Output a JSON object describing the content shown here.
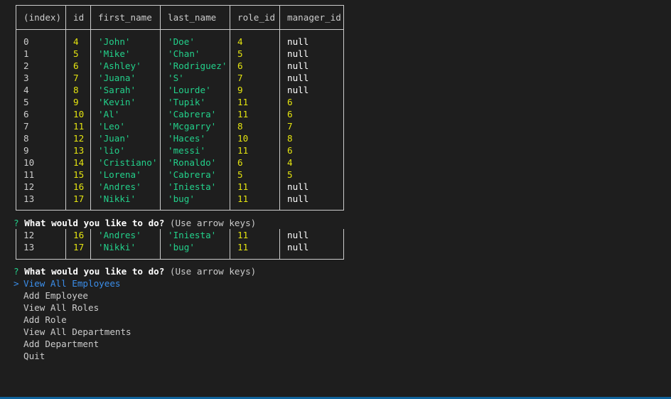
{
  "table": {
    "columns": [
      "(index)",
      "id",
      "first_name",
      "last_name",
      "role_id",
      "manager_id"
    ],
    "rows": [
      {
        "index": "0",
        "id": "4",
        "first_name": "'John'",
        "last_name": "'Doe'",
        "role_id": "4",
        "manager_id": "null"
      },
      {
        "index": "1",
        "id": "5",
        "first_name": "'Mike'",
        "last_name": "'Chan'",
        "role_id": "5",
        "manager_id": "null"
      },
      {
        "index": "2",
        "id": "6",
        "first_name": "'Ashley'",
        "last_name": "'Rodriguez'",
        "role_id": "6",
        "manager_id": "null"
      },
      {
        "index": "3",
        "id": "7",
        "first_name": "'Juana'",
        "last_name": "'S'",
        "role_id": "7",
        "manager_id": "null"
      },
      {
        "index": "4",
        "id": "8",
        "first_name": "'Sarah'",
        "last_name": "'Lourde'",
        "role_id": "9",
        "manager_id": "null"
      },
      {
        "index": "5",
        "id": "9",
        "first_name": "'Kevin'",
        "last_name": "'Tupik'",
        "role_id": "11",
        "manager_id": "6"
      },
      {
        "index": "6",
        "id": "10",
        "first_name": "'Al'",
        "last_name": "'Cabrera'",
        "role_id": "11",
        "manager_id": "6"
      },
      {
        "index": "7",
        "id": "11",
        "first_name": "'Leo'",
        "last_name": "'Mcgarry'",
        "role_id": "8",
        "manager_id": "7"
      },
      {
        "index": "8",
        "id": "12",
        "first_name": "'Juan'",
        "last_name": "'Haces'",
        "role_id": "10",
        "manager_id": "8"
      },
      {
        "index": "9",
        "id": "13",
        "first_name": "'lio'",
        "last_name": "'messi'",
        "role_id": "11",
        "manager_id": "6"
      },
      {
        "index": "10",
        "id": "14",
        "first_name": "'Cristiano'",
        "last_name": "'Ronaldo'",
        "role_id": "6",
        "manager_id": "4"
      },
      {
        "index": "11",
        "id": "15",
        "first_name": "'Lorena'",
        "last_name": "'Cabrera'",
        "role_id": "5",
        "manager_id": "5"
      },
      {
        "index": "12",
        "id": "16",
        "first_name": "'Andres'",
        "last_name": "'Iniesta'",
        "role_id": "11",
        "manager_id": "null"
      },
      {
        "index": "13",
        "id": "17",
        "first_name": "'Nikki'",
        "last_name": "'bug'",
        "role_id": "11",
        "manager_id": "null"
      }
    ]
  },
  "prompt_first": {
    "mark": "?",
    "question": "What would you like to do?",
    "hint": "(Use arrow keys)"
  },
  "partial_table": {
    "rows": [
      {
        "index": "12",
        "id": "16",
        "first_name": "'Andres'",
        "last_name": "'Iniesta'",
        "role_id": "11",
        "manager_id": "null"
      },
      {
        "index": "13",
        "id": "17",
        "first_name": "'Nikki'",
        "last_name": "'bug'",
        "role_id": "11",
        "manager_id": "null"
      }
    ]
  },
  "prompt_second": {
    "mark": "?",
    "question": "What would you like to do?",
    "hint": "(Use arrow keys)"
  },
  "menu": {
    "pointer": ">",
    "items": [
      "View All Employees",
      "Add Employee",
      "View All Roles",
      "Add Role",
      "View All Departments",
      "Add Department",
      "Quit"
    ]
  },
  "colors": {
    "background": "#1e1e1e",
    "number": "#e5e510",
    "string": "#23d18b",
    "null": "#ffffff",
    "selected": "#3b8eea",
    "status_bar": "#0e639c"
  }
}
